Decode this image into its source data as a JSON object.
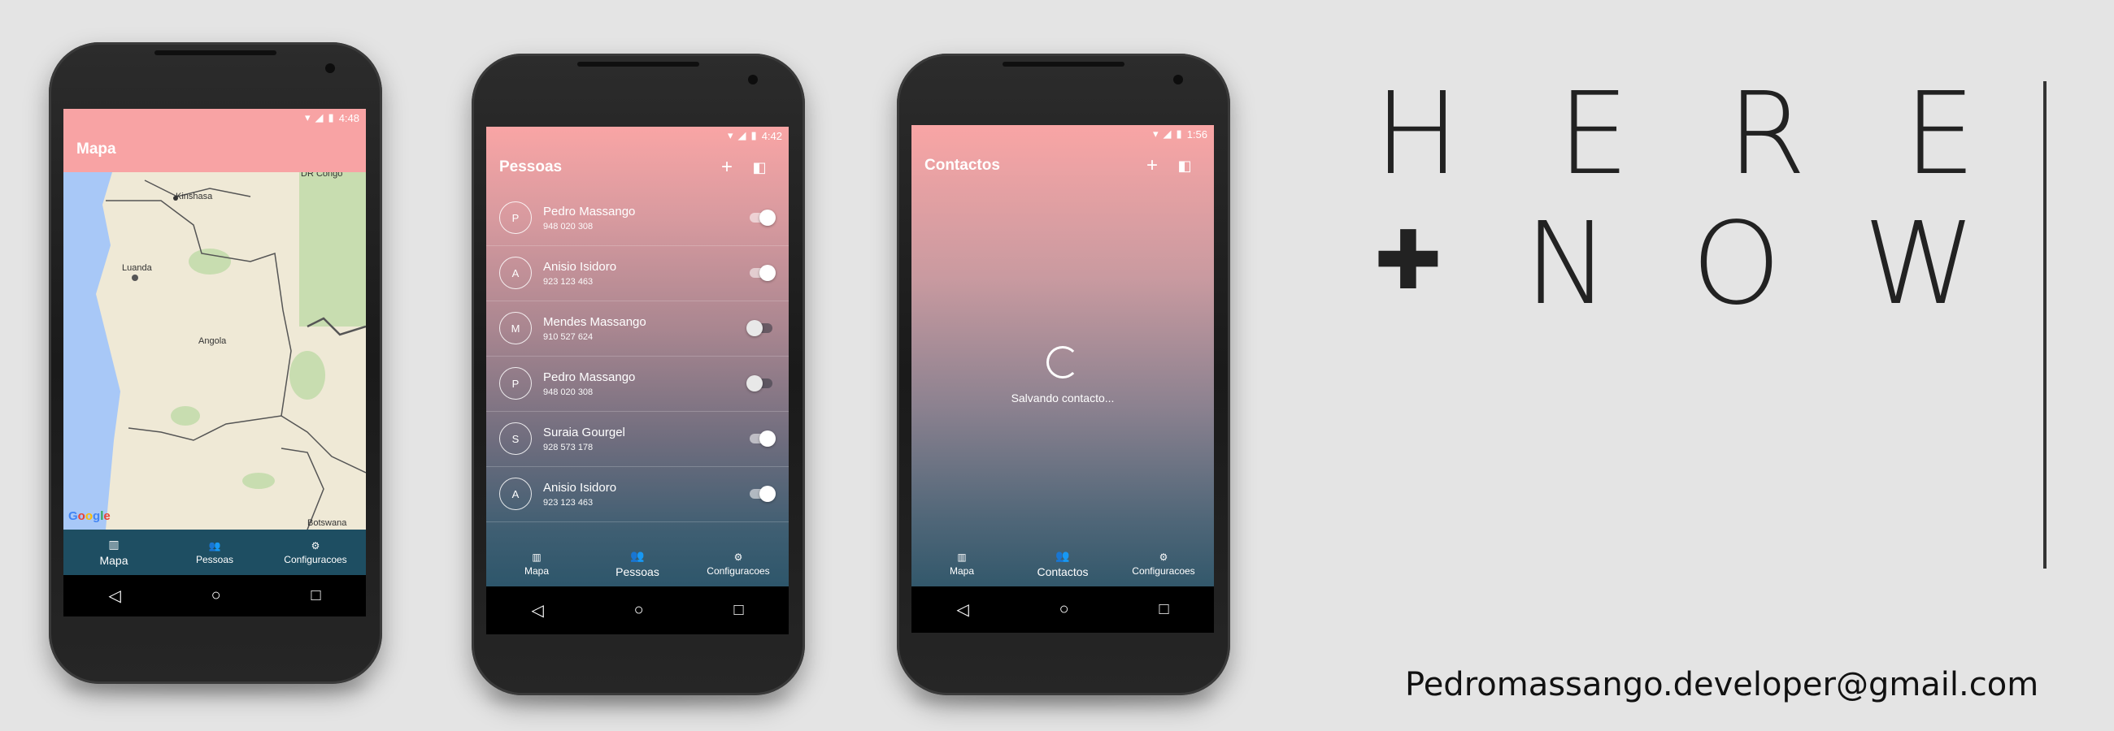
{
  "phones": {
    "map": {
      "status_time": "4:48",
      "title": "Mapa",
      "labels": {
        "kinshasa": "Kinshasa",
        "luanda": "Luanda",
        "angola": "Angola",
        "botswana": "Botswana",
        "dr_congo": "DR Congo"
      },
      "google": "Google",
      "nav": [
        "Mapa",
        "Pessoas",
        "Configuracoes"
      ]
    },
    "people": {
      "status_time": "4:42",
      "title": "Pessoas",
      "add_icon": "+",
      "rows": [
        {
          "initial": "P",
          "name": "Pedro Massango",
          "phone": "948 020 308",
          "enabled": true
        },
        {
          "initial": "A",
          "name": "Anisio Isidoro",
          "phone": "923 123 463",
          "enabled": true
        },
        {
          "initial": "M",
          "name": "Mendes Massango",
          "phone": "910 527 624",
          "enabled": false
        },
        {
          "initial": "P",
          "name": "Pedro Massango",
          "phone": "948 020 308",
          "enabled": false
        },
        {
          "initial": "S",
          "name": "Suraia Gourgel",
          "phone": "928 573 178",
          "enabled": true
        },
        {
          "initial": "A",
          "name": "Anisio Isidoro",
          "phone": "923 123 463",
          "enabled": true
        }
      ],
      "nav": [
        "Mapa",
        "Pessoas",
        "Configuracoes"
      ]
    },
    "contacts": {
      "status_time": "1:56",
      "title": "Contactos",
      "add_icon": "+",
      "loading_text": "Salvando contacto...",
      "nav": [
        "Mapa",
        "Contactos",
        "Configuracoes"
      ]
    }
  },
  "brand": {
    "row1": [
      "H",
      "E",
      "R",
      "E"
    ],
    "row2": [
      "N",
      "O",
      "W"
    ],
    "plus": "✚"
  },
  "email": "Pedromassango.developer@gmail.com",
  "colors": {
    "accent_pink": "#f8a3a4",
    "nav_teal": "#1e4e62"
  }
}
